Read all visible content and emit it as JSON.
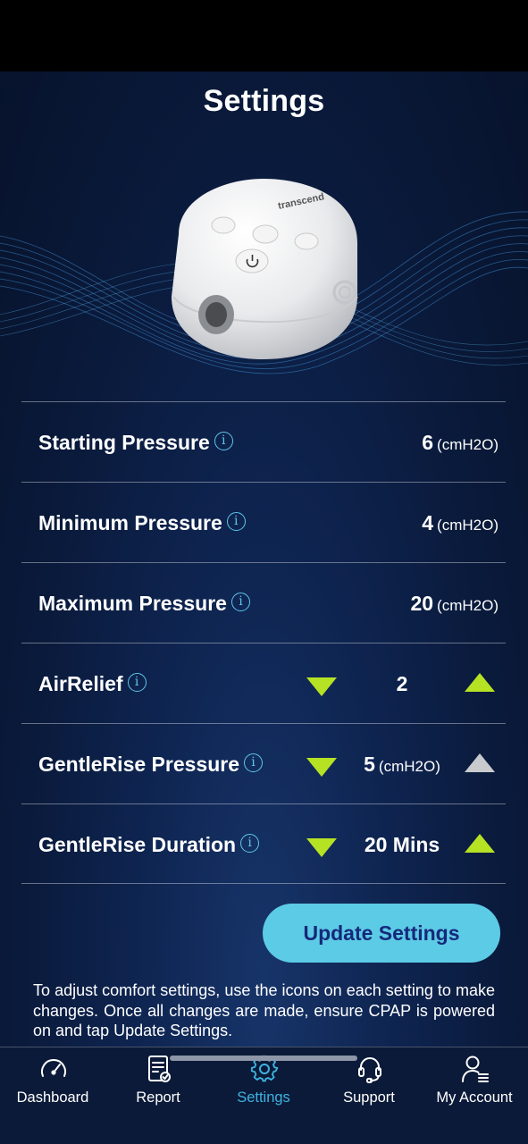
{
  "page": {
    "title": "Settings"
  },
  "device": {
    "brand": "transcend"
  },
  "settings": [
    {
      "label": "Starting Pressure",
      "value": "6",
      "unit": "(cmH2O)"
    },
    {
      "label": "Minimum Pressure",
      "value": "4",
      "unit": "(cmH2O)"
    },
    {
      "label": "Maximum Pressure",
      "value": "20",
      "unit": "(cmH2O)"
    },
    {
      "label": "AirRelief",
      "value": "2",
      "unit": ""
    },
    {
      "label": "GentleRise Pressure",
      "value": "5",
      "unit": "(cmH2O)",
      "increase_enabled": false
    },
    {
      "label": "GentleRise Duration",
      "value": "20 Mins",
      "unit": ""
    }
  ],
  "info_icon_glyph": "i",
  "update_button": {
    "label": "Update Settings"
  },
  "help_text": "To adjust comfort settings, use the icons on each setting to make changes. Once all changes are made, ensure CPAP is powered on and tap Update Settings.",
  "tabs": [
    {
      "label": "Dashboard",
      "icon": "gauge-icon",
      "active": false
    },
    {
      "label": "Report",
      "icon": "report-icon",
      "active": false
    },
    {
      "label": "Settings",
      "icon": "gear-icon",
      "active": true
    },
    {
      "label": "Support",
      "icon": "headset-icon",
      "active": false
    },
    {
      "label": "My Account",
      "icon": "account-icon",
      "active": false
    }
  ],
  "colors": {
    "accent": "#5ccbe6",
    "arrow_active": "#b6e224",
    "arrow_disabled": "#c8cacd",
    "tab_active": "#3fb3e0",
    "button_text": "#15297a"
  }
}
